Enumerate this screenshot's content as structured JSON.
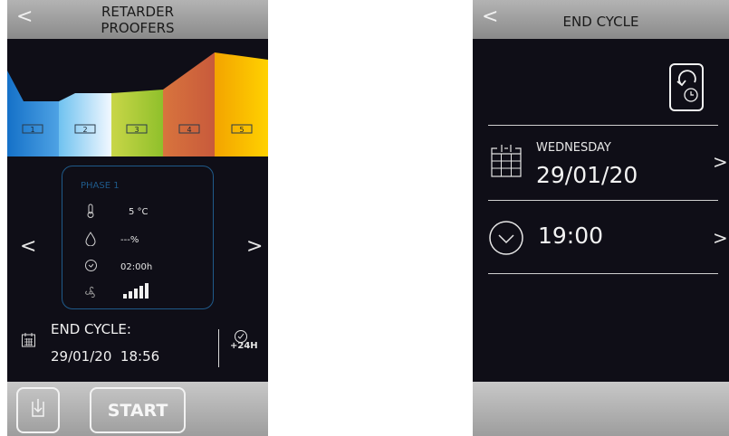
{
  "left": {
    "header": {
      "back_label": "<",
      "title_line1": "RETARDER",
      "title_line2": "PROOFERS"
    },
    "chart": {
      "phases": [
        "1",
        "2",
        "3",
        "4",
        "5"
      ],
      "phase_colors": [
        "#1f7fd3",
        "#e0f2ff",
        "#a3c82e",
        "#e0874a",
        "#f4b400"
      ]
    },
    "phase_card": {
      "name": "PHASE 1",
      "temperature": "5 °C",
      "humidity": "---%",
      "time": "02:00h",
      "fan_level": 5
    },
    "nav": {
      "prev": "<",
      "next": ">"
    },
    "end_cycle": {
      "label": "END CYCLE:",
      "date": "29/01/20",
      "time": "18:56",
      "badge": "+24H"
    },
    "footer": {
      "start_label": "START"
    }
  },
  "right": {
    "header": {
      "back_label": "<",
      "title": "END CYCLE"
    },
    "date_row": {
      "day": "WEDNESDAY",
      "date": "29/01/20",
      "chevron": ">"
    },
    "time_row": {
      "time": "19:00",
      "chevron": ">"
    }
  }
}
